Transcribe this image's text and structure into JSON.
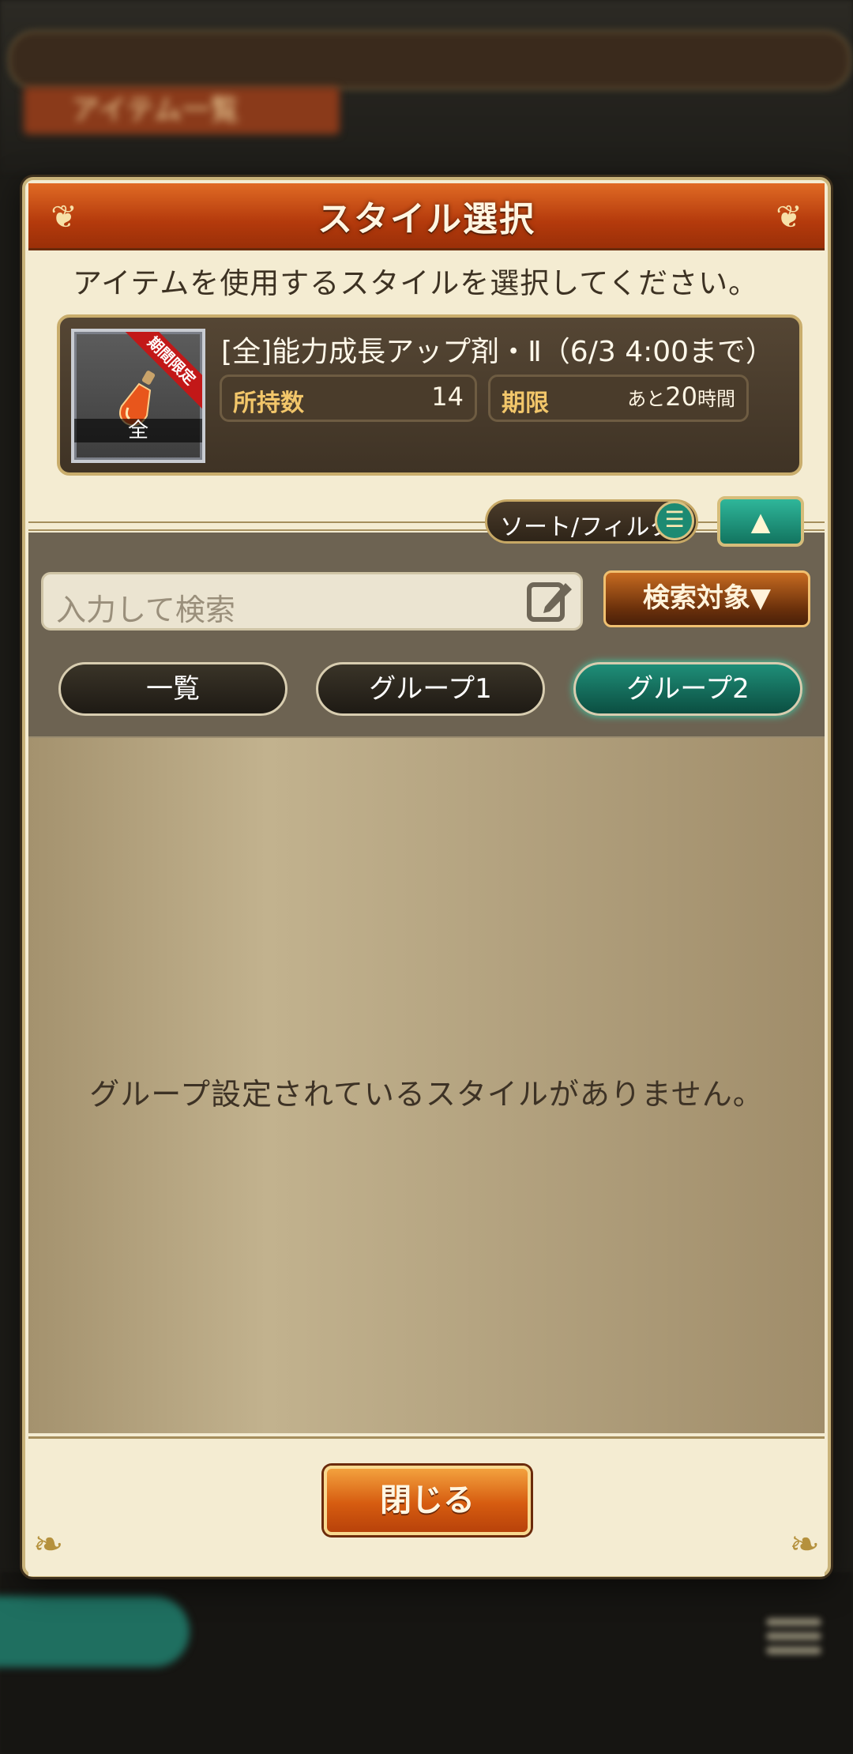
{
  "background": {
    "hud_values": [
      "",
      "",
      "",
      ""
    ],
    "screen_title": "アイテム一覧"
  },
  "dialog": {
    "title": "スタイル選択",
    "instruction": "アイテムを使用するスタイルを選択してください。",
    "item": {
      "name": "[全]能力成長アップ剤・Ⅱ（6/3 4:00まで）",
      "ribbon": "期間限定",
      "icon_tag": "全",
      "icon": "potion-bottle-icon",
      "owned_label": "所持数",
      "owned_value": "14",
      "expiry_label": "期限",
      "expiry_prefix": "あと",
      "expiry_number": "20",
      "expiry_unit": "時間"
    },
    "sort_filter_label": "ソート/フィルタ",
    "search": {
      "placeholder": "入力して検索",
      "target_label": "検索対象▼"
    },
    "tabs": [
      {
        "label": "一覧",
        "active": false
      },
      {
        "label": "グループ1",
        "active": false
      },
      {
        "label": "グループ2",
        "active": true
      }
    ],
    "empty_message": "グループ設定されているスタイルがありません。",
    "close_label": "閉じる"
  },
  "colors": {
    "header_orange": "#c24a14",
    "accent_teal": "#1d8a72",
    "label_gold": "#f2c66a"
  }
}
